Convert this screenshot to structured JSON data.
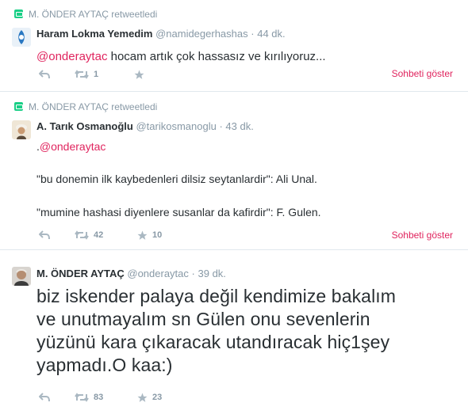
{
  "tweets": [
    {
      "retweeted_by": "M. ÖNDER AYTAÇ",
      "retweeted_suffix": "retweetledi",
      "name": "Haram Lokma Yemedim",
      "handle": "@namidegerhashas",
      "time": "44 dk.",
      "mention": "@onderaytac",
      "text": " hocam artık çok hassasız ve kırılıyoruz...",
      "retweets": "1",
      "favorites": "",
      "conversation": "Sohbeti göster"
    },
    {
      "retweeted_by": "M. ÖNDER AYTAÇ",
      "retweeted_suffix": "retweetledi",
      "name": "A. Tarık Osmanoğlu",
      "handle": "@tarikosmanoglu",
      "time": "43 dk.",
      "prefix": ".",
      "mention": "@onderaytac",
      "line2": "\"bu donemin ilk kaybedenleri dilsiz seytanlardir\": Ali Unal.",
      "line3": "\"mumine hashasi diyenlere susanlar da kafirdir\": F. Gulen.",
      "retweets": "42",
      "favorites": "10",
      "conversation": "Sohbeti göster"
    },
    {
      "name": "M. ÖNDER AYTAÇ",
      "handle": "@onderaytac",
      "time": "39 dk.",
      "text_lines": [
        "biz iskender palaya değil kendimize bakalım",
        "ve unutmayalım sn Gülen onu sevenlerin",
        "yüzünü kara çıkaracak utandıracak hiç1şey",
        "yapmadı.O kaa:)"
      ],
      "retweets": "83",
      "favorites": "23"
    }
  ],
  "separator": "·",
  "colors": {
    "accent": "#e0245e",
    "retweet_green": "#19cf86",
    "muted": "#8899a6",
    "text": "#292f33"
  }
}
